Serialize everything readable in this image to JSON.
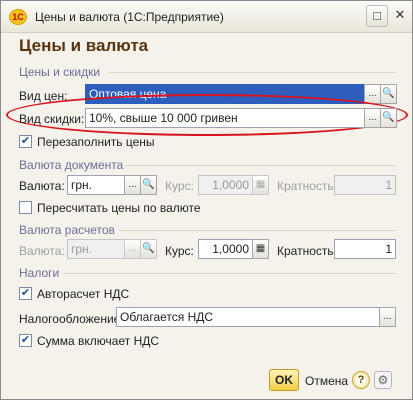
{
  "window": {
    "title": "Цены и валюта  (1С:Предприятие)",
    "logo": "1С",
    "maximize_icon": "□",
    "close_icon": "✕"
  },
  "form": {
    "heading": "Цены и валюта"
  },
  "prices_discounts": {
    "group_title": "Цены и скидки",
    "price_type_label": "Вид цен:",
    "price_type_value": "Оптовая цена",
    "discount_type_label": "Вид скидки:",
    "discount_type_value": "10%, свыше 10 000 гривен",
    "refill_prices_label": "Перезаполнить цены",
    "refill_prices_checked": true
  },
  "document_currency": {
    "group_title": "Валюта документа",
    "currency_label": "Валюта:",
    "currency_value": "грн.",
    "rate_label": "Курс:",
    "rate_value": "1,0000",
    "multiplicity_label": "Кратность:",
    "multiplicity_value": "1",
    "recalc_label": "Пересчитать цены по валюте",
    "recalc_checked": false
  },
  "settlement_currency": {
    "group_title": "Валюта расчетов",
    "currency_label": "Валюта:",
    "currency_value": "грн.",
    "rate_label": "Курс:",
    "rate_value": "1,0000",
    "multiplicity_label": "Кратность:",
    "multiplicity_value": "1"
  },
  "taxes": {
    "group_title": "Налоги",
    "auto_vat_label": "Авторасчет НДС",
    "auto_vat_checked": true,
    "taxation_label": "Налогообложение:",
    "taxation_value": "Облагается НДС",
    "sum_includes_vat_label": "Сумма включает НДС",
    "sum_includes_vat_checked": true
  },
  "buttons": {
    "ok": "OK",
    "cancel": "Отмена",
    "help": "?",
    "ellipsis": "...",
    "search": "🔍",
    "check": "✔"
  },
  "colors": {
    "heading": "#5a3410",
    "group_title": "#6e6e9a",
    "selection": "#2d5dbd",
    "annotation_oval": "#d8141e",
    "ok_button": "#f1cf47"
  }
}
